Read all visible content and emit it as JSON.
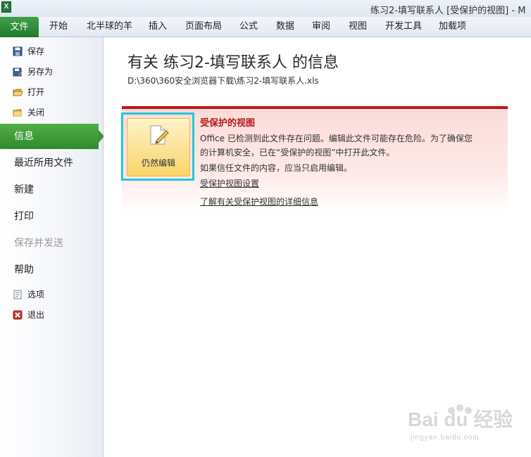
{
  "window": {
    "title": "练习2-填写联系人 [受保护的视图] - M",
    "app_icon_letter": "X"
  },
  "ribbon": {
    "file_tab": "文件",
    "tabs": [
      "开始",
      "北半球的羊",
      "插入",
      "页面布局",
      "公式",
      "数据",
      "审阅",
      "视图",
      "开发工具",
      "加载项"
    ]
  },
  "backstage": {
    "commands": [
      {
        "label": "保存",
        "icon": "save-icon"
      },
      {
        "label": "另存为",
        "icon": "save-as-icon"
      },
      {
        "label": "打开",
        "icon": "open-folder-icon"
      },
      {
        "label": "关闭",
        "icon": "close-folder-icon"
      }
    ],
    "nav": [
      {
        "label": "信息",
        "state": "active"
      },
      {
        "label": "最近所用文件",
        "state": "normal"
      },
      {
        "label": "新建",
        "state": "normal"
      },
      {
        "label": "打印",
        "state": "normal"
      },
      {
        "label": "保存并发送",
        "state": "disabled"
      },
      {
        "label": "帮助",
        "state": "normal"
      }
    ],
    "bottom_commands": [
      {
        "label": "选项",
        "icon": "options-icon"
      },
      {
        "label": "退出",
        "icon": "exit-icon"
      }
    ]
  },
  "info": {
    "title": "有关 练习2-填写联系人 的信息",
    "path": "D:\\360\\360安全浏览器下载\\练习2-填写联系人.xls"
  },
  "protected_view": {
    "button_label": "仍然编辑",
    "heading": "受保护的视图",
    "lines": [
      "Office 已检测到此文件存在问题。编辑此文件可能存在危险。为了确保您",
      "的计算机安全，已在“受保护的视图”中打开此文件。",
      "如果信任文件的内容，应当只启用编辑。"
    ],
    "settings_link": "受保护视图设置",
    "learn_more_link": "了解有关受保护视图的详细信息"
  },
  "watermark": {
    "brand": "Bai du 经验",
    "url": "jingyan.baidu.com"
  },
  "colors": {
    "file_tab": "#217a2b",
    "active_nav": "#3a9735",
    "protected_bar": "#c0141c",
    "highlight_frame": "#23c8d8"
  }
}
